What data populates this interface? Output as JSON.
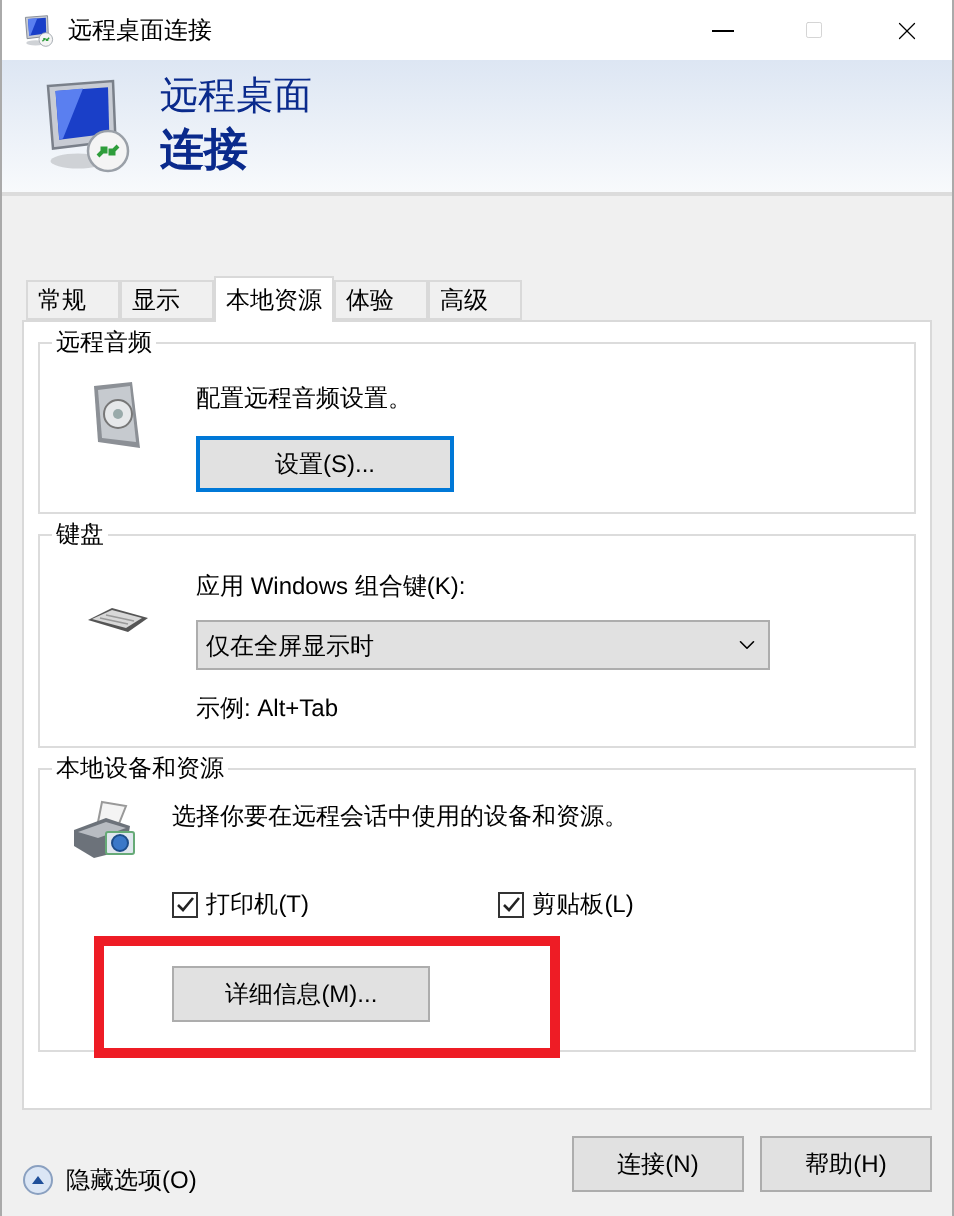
{
  "window": {
    "title": "远程桌面连接"
  },
  "header": {
    "line_1": "远程桌面",
    "line_2": "连接"
  },
  "tabs": [
    {
      "label": "常规",
      "selected": false
    },
    {
      "label": "显示",
      "selected": false
    },
    {
      "label": "本地资源",
      "selected": true
    },
    {
      "label": "体验",
      "selected": false
    },
    {
      "label": "高级",
      "selected": false
    }
  ],
  "groups": [
    {
      "kind": "audio",
      "title": "远程音频",
      "description": "配置远程音频设置。",
      "button": {
        "label": "设置(S)...",
        "focused": true
      }
    },
    {
      "kind": "keyboard",
      "title": "键盘",
      "label": "应用 Windows 组合键(K):",
      "dropdown": {
        "value": "仅在全屏显示时"
      },
      "example": "示例: Alt+Tab"
    },
    {
      "kind": "devices",
      "title": "本地设备和资源",
      "description": "选择你要在远程会话中使用的设备和资源。",
      "checkboxes": [
        {
          "label": "打印机(T)",
          "checked": true
        },
        {
          "label": "剪贴板(L)",
          "checked": true
        }
      ],
      "button": {
        "label": "详细信息(M)...",
        "focused": false,
        "highlighted": true
      }
    }
  ],
  "footer": {
    "toggle": "隐藏选项(O)",
    "buttons": [
      "连接(N)",
      "帮助(H)"
    ]
  }
}
